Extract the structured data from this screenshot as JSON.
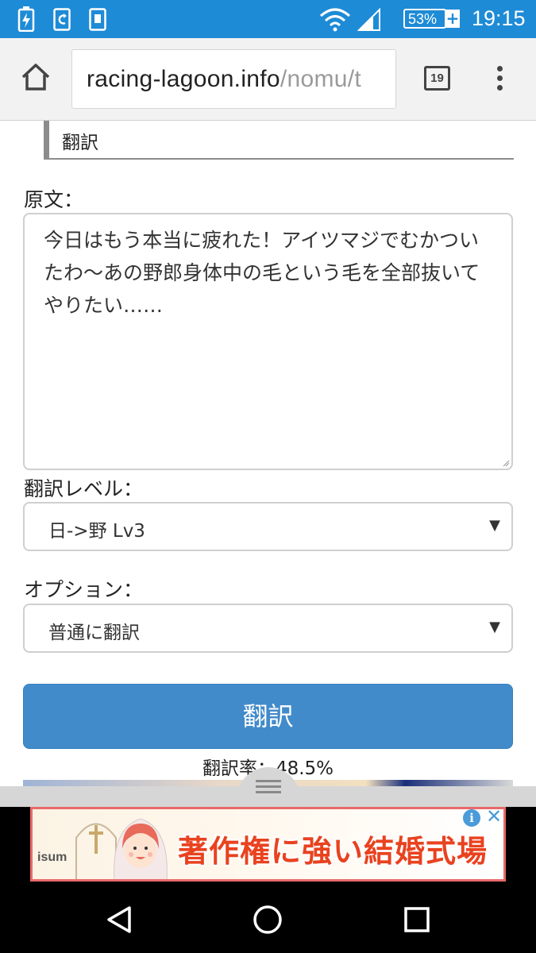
{
  "status_bar": {
    "battery_percent": "53%",
    "time": "19:15",
    "background_color": "#1e8bd6"
  },
  "browser": {
    "url_host": "racing-lagoon.info",
    "url_path": "/nomu/t",
    "tab_count": "19",
    "icons": [
      "home-icon",
      "tabs-icon",
      "overflow-menu-icon"
    ]
  },
  "page": {
    "section_title": "翻訳",
    "source_label": "原文：",
    "source_text": "今日はもう本当に疲れた！アイツマジでむかついたわ〜あの野郎身体中の毛という毛を全部抜いてやりたい……",
    "level_label": "翻訳レベル：",
    "level_value": "日->野 Lv3",
    "option_label": "オプション：",
    "option_value": "普通に翻訳",
    "translate_button": "翻訳",
    "rate_text": "翻訳率：48.5%",
    "button_color": "#428bca"
  },
  "ad": {
    "banner_text": "著作権に強い結婚式場",
    "brand": "isum",
    "info_icon": "i",
    "close_icon": "✕"
  },
  "nav": {
    "icons": [
      "back-icon",
      "home-nav-icon",
      "recents-icon"
    ]
  }
}
